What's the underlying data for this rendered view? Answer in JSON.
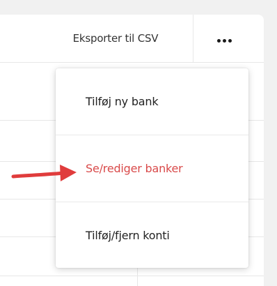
{
  "toolbar": {
    "export_label": "Eksporter til CSV",
    "more_icon": "more-horizontal-icon"
  },
  "menu": {
    "items": [
      {
        "label": "Tilføj ny bank"
      },
      {
        "label": "Se/rediger banker"
      },
      {
        "label": "Tilføj/fjern konti"
      }
    ],
    "selected_color": "#d94a4a"
  },
  "annotation": {
    "arrow_color": "#e03c3c",
    "arrow_icon": "red-pointer-arrow"
  }
}
